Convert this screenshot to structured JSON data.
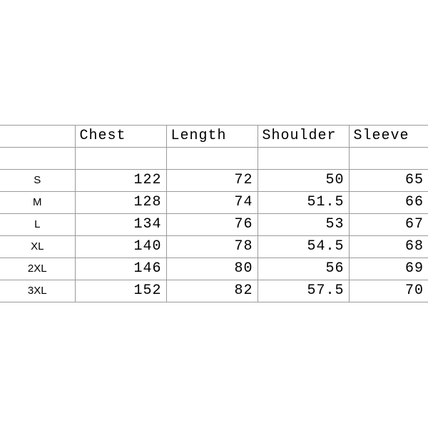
{
  "chart_data": {
    "type": "table",
    "title": "",
    "columns": [
      "",
      "Chest",
      "Length",
      "Shoulder",
      "Sleeve"
    ],
    "rows": [
      {
        "size": "S",
        "chest": 122,
        "length": 72,
        "shoulder": 50,
        "sleeve": 65
      },
      {
        "size": "M",
        "chest": 128,
        "length": 74,
        "shoulder": 51.5,
        "sleeve": 66
      },
      {
        "size": "L",
        "chest": 134,
        "length": 76,
        "shoulder": 53,
        "sleeve": 67
      },
      {
        "size": "XL",
        "chest": 140,
        "length": 78,
        "shoulder": 54.5,
        "sleeve": 68
      },
      {
        "size": "2XL",
        "chest": 146,
        "length": 80,
        "shoulder": 56,
        "sleeve": 69
      },
      {
        "size": "3XL",
        "chest": 152,
        "length": 82,
        "shoulder": 57.5,
        "sleeve": 70
      }
    ]
  },
  "headers": {
    "size": "",
    "chest": "Chest",
    "length": "Length",
    "shoulder": "Shoulder",
    "sleeve": "Sleeve"
  },
  "rows": [
    {
      "size": "S",
      "chest": "122",
      "length": "72",
      "shoulder": "50",
      "sleeve": "65"
    },
    {
      "size": "M",
      "chest": "128",
      "length": "74",
      "shoulder": "51.5",
      "sleeve": "66"
    },
    {
      "size": "L",
      "chest": "134",
      "length": "76",
      "shoulder": "53",
      "sleeve": "67"
    },
    {
      "size": "XL",
      "chest": "140",
      "length": "78",
      "shoulder": "54.5",
      "sleeve": "68"
    },
    {
      "size": "2XL",
      "chest": "146",
      "length": "80",
      "shoulder": "56",
      "sleeve": "69"
    },
    {
      "size": "3XL",
      "chest": "152",
      "length": "82",
      "shoulder": "57.5",
      "sleeve": "70"
    }
  ]
}
